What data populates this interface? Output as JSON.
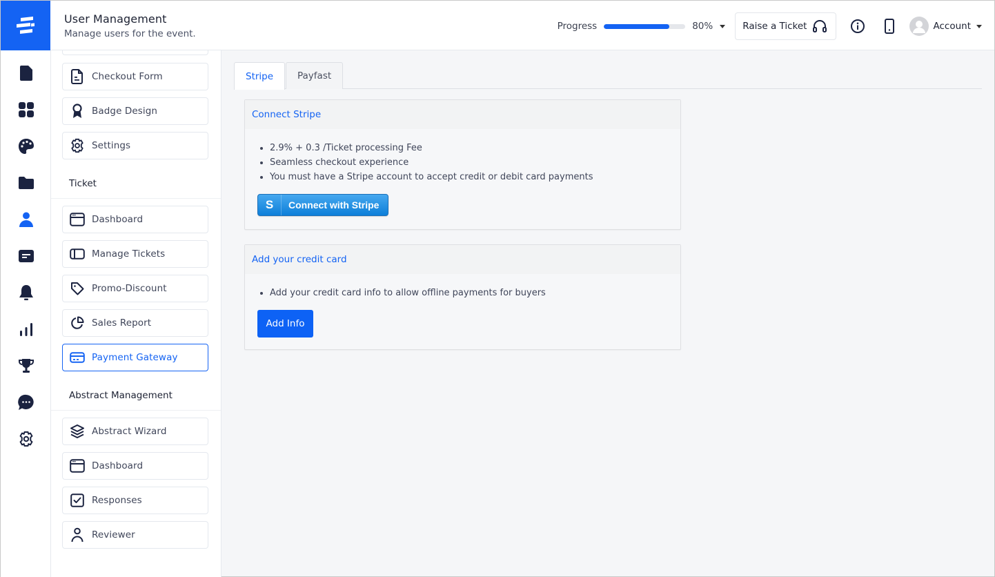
{
  "header": {
    "title": "User Management",
    "subtitle": "Manage users for the event.",
    "progress": {
      "label": "Progress",
      "value_percent": 80,
      "value_text": "80%"
    },
    "raise_ticket_label": "Raise a Ticket",
    "account_label": "Account"
  },
  "rail": {
    "items": [
      {
        "icon": "document-icon"
      },
      {
        "icon": "grid-icon"
      },
      {
        "icon": "palette-icon"
      },
      {
        "icon": "folder-icon"
      },
      {
        "icon": "user-icon",
        "active": true
      },
      {
        "icon": "form-icon"
      },
      {
        "icon": "bell-icon"
      },
      {
        "icon": "bar-chart-icon"
      },
      {
        "icon": "trophy-icon"
      },
      {
        "icon": "chat-icon"
      },
      {
        "icon": "gear-icon"
      }
    ]
  },
  "sidebar": {
    "top_items": [
      {
        "label": "Checkout Form",
        "icon": "form-doc-icon"
      },
      {
        "label": "Badge Design",
        "icon": "badge-icon"
      },
      {
        "label": "Settings",
        "icon": "gear-icon"
      }
    ],
    "ticket_section": {
      "title": "Ticket",
      "items": [
        {
          "label": "Dashboard",
          "icon": "window-icon"
        },
        {
          "label": "Manage Tickets",
          "icon": "panel-icon"
        },
        {
          "label": "Promo-Discount",
          "icon": "tag-icon"
        },
        {
          "label": "Sales Report",
          "icon": "pie-chart-icon"
        },
        {
          "label": "Payment Gateway",
          "icon": "credit-card-icon",
          "active": true
        }
      ]
    },
    "abstract_section": {
      "title": "Abstract Management",
      "items": [
        {
          "label": "Abstract Wizard",
          "icon": "layers-icon"
        },
        {
          "label": "Dashboard",
          "icon": "window-icon"
        },
        {
          "label": "Responses",
          "icon": "checkbox-icon"
        },
        {
          "label": "Reviewer",
          "icon": "person-icon"
        }
      ]
    }
  },
  "main": {
    "tabs": [
      {
        "label": "Stripe",
        "active": true
      },
      {
        "label": "Payfast",
        "active": false
      }
    ],
    "stripe_card": {
      "title": "Connect Stripe",
      "bullets": [
        "2.9% + 0.3 /Ticket processing Fee",
        "Seamless checkout experience",
        "You must have a Stripe account to accept credit or debit card payments"
      ],
      "button_glyph": "S",
      "button_label": "Connect with Stripe"
    },
    "credit_card": {
      "title": "Add your credit card",
      "bullets": [
        "Add your credit card info to allow offline payments for buyers"
      ],
      "button_label": "Add Info"
    }
  },
  "colors": {
    "accent": "#1463f3",
    "icon_dark": "#1b2340",
    "stripe_button": "#1a8ae6"
  }
}
